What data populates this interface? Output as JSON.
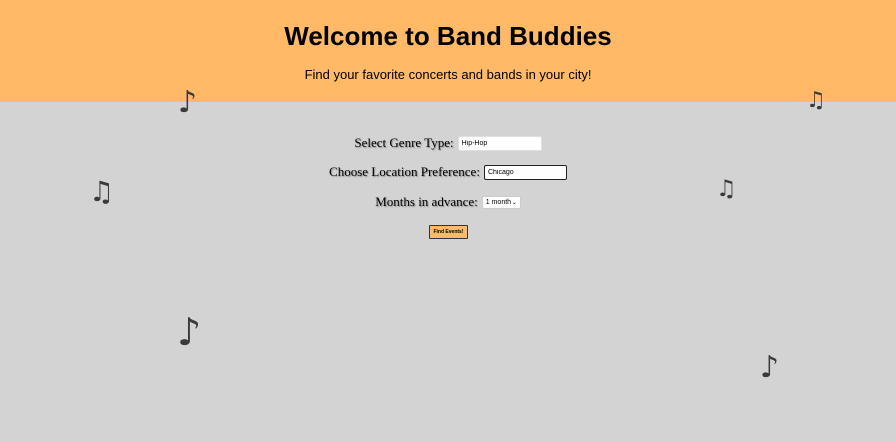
{
  "header": {
    "title": "Welcome to Band Buddies",
    "subtitle": "Find your favorite concerts and bands in your city!"
  },
  "form": {
    "genre_label": "Select Genre Type:",
    "genre_value": "Hip-Hop",
    "location_label": "Choose Location Preference:",
    "location_value": "Chicago",
    "months_label": "Months in advance:",
    "months_selected": "1 month",
    "submit_label": "Find Events!"
  },
  "decorations": {
    "note_single": "♪",
    "note_double": "♫",
    "note_color": "#3a3a3a"
  },
  "colors": {
    "header_bg": "#ffb967",
    "page_bg": "#d3d3d3",
    "button_bg": "#ffb967"
  }
}
